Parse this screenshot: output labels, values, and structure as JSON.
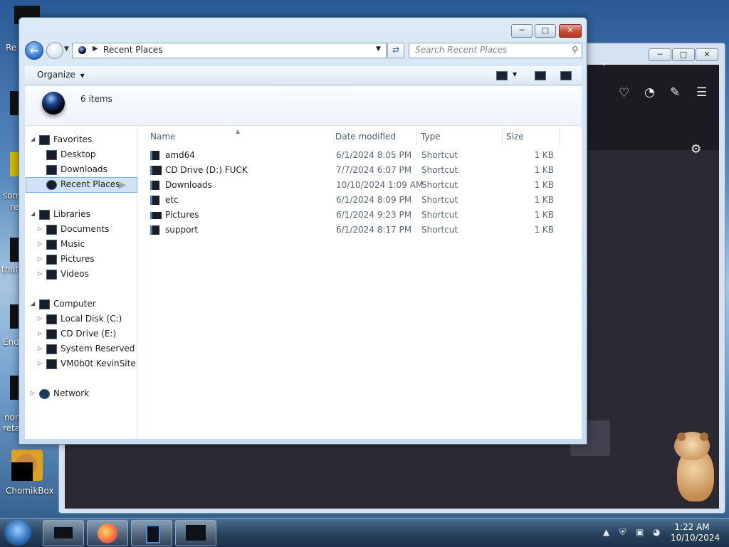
{
  "desktop": {
    "left_fragments": [
      "Re",
      "som",
      "re",
      "that",
      "End",
      "non",
      "reta"
    ],
    "chomikbox_label": "ChomikBox"
  },
  "explorer": {
    "address": "Recent Places",
    "search_placeholder": "Search Recent Places",
    "organize_label": "Organize",
    "items_count": "6 items",
    "columns": {
      "name": "Name",
      "date": "Date modified",
      "type": "Type",
      "size": "Size"
    },
    "nav": {
      "favorites": "Favorites",
      "desktop": "Desktop",
      "downloads": "Downloads",
      "recent_places": "Recent Places",
      "libraries": "Libraries",
      "documents": "Documents",
      "music": "Music",
      "pictures": "Pictures",
      "videos": "Videos",
      "computer": "Computer",
      "local_disk": "Local Disk (C:)",
      "cd_drive": "CD Drive (E:)",
      "system_reserved": "System Reserved (F:)",
      "vm": "VM0b0t KevinSite",
      "network": "Network"
    },
    "files": [
      {
        "name": "amd64",
        "date": "6/1/2024 8:05 PM",
        "type": "Shortcut",
        "size": "1 KB"
      },
      {
        "name": "CD Drive (D:) FUCK",
        "date": "7/7/2024 6:07 PM",
        "type": "Shortcut",
        "size": "1 KB"
      },
      {
        "name": "Downloads",
        "date": "10/10/2024 1:09 AM",
        "type": "Shortcut",
        "size": "1 KB"
      },
      {
        "name": "etc",
        "date": "6/1/2024 8:09 PM",
        "type": "Shortcut",
        "size": "1 KB"
      },
      {
        "name": "Pictures",
        "date": "6/1/2024 9:23 PM",
        "type": "Shortcut",
        "size": "1 KB"
      },
      {
        "name": "support",
        "date": "6/1/2024 8:17 PM",
        "type": "Shortcut",
        "size": "1 KB"
      }
    ]
  },
  "taskbar": {
    "time": "1:22 AM",
    "date": "10/10/2024"
  },
  "icons": {
    "back": "back-arrow-icon",
    "forward": "forward-arrow-icon",
    "refresh": "refresh-icon",
    "search": "search-icon",
    "pocket": "pocket-icon",
    "account": "account-icon",
    "extensions": "extensions-icon",
    "menu": "hamburger-menu-icon",
    "settings": "gear-icon"
  }
}
